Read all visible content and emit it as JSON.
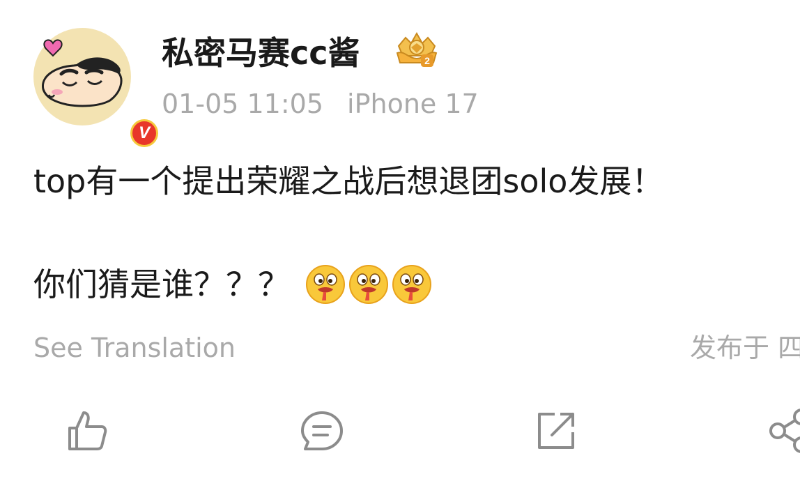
{
  "post": {
    "author": {
      "name": "私密马赛cc酱",
      "verified_mark": "V",
      "avatar_icon": "cartoon-boy-heart-avatar",
      "badge_icon": "crown-level-badge",
      "badge_number": "2"
    },
    "meta": {
      "timestamp": "01-05 11:05",
      "device": "iPhone 17"
    },
    "content": {
      "line1": "top有一个提出荣耀之战后想退团solo发展！",
      "line2": "你们猜是谁？？？",
      "emojis": [
        "drooling-face-emoji",
        "drooling-face-emoji",
        "drooling-face-emoji"
      ]
    },
    "see_translation": "See Translation",
    "published_from": "发布于 四"
  },
  "actions": [
    {
      "icon": "like-icon"
    },
    {
      "icon": "comment-icon"
    },
    {
      "icon": "repost-icon"
    },
    {
      "icon": "share-icon"
    }
  ],
  "colors": {
    "text_primary": "#1a1a1a",
    "text_secondary": "#a9a9a9",
    "verified_red": "#e8362a",
    "badge_gold": "#f6c93b",
    "icon_gray": "#8c8c8c"
  }
}
